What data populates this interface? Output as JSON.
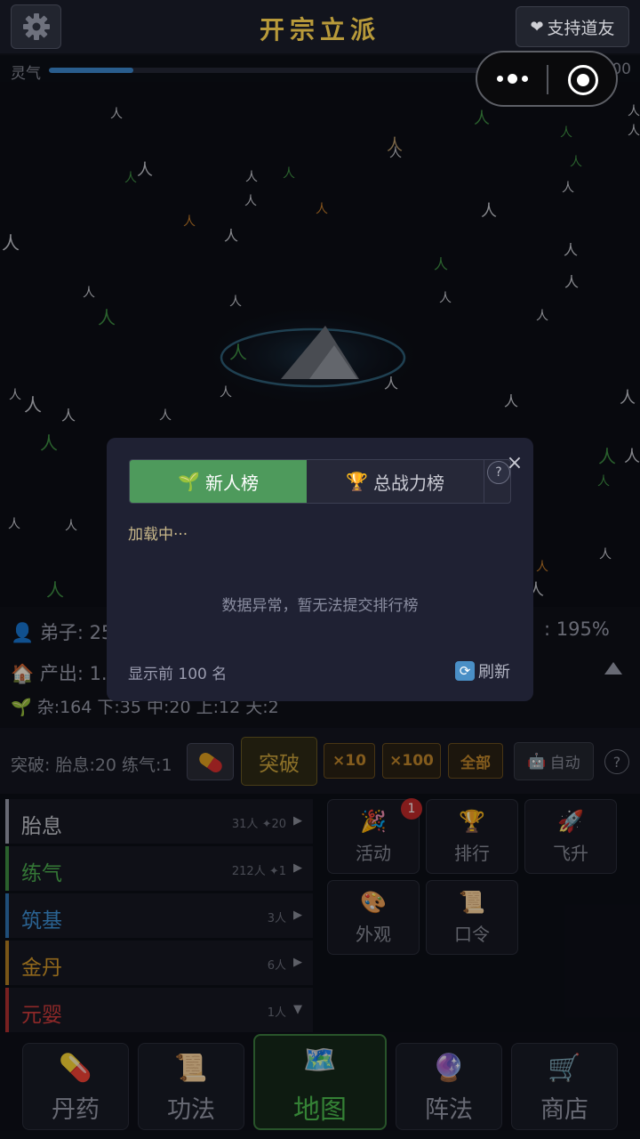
{
  "header": {
    "title": "开宗立派",
    "support_label": "支持道友",
    "settings_icon": "gear-icon",
    "support_icon": "heart-icon"
  },
  "lingqi": {
    "label": "灵气",
    "value_text": "3 / 2000",
    "fill_fraction": 0.17
  },
  "capsule": {
    "more_icon": "more-dots-icon",
    "close_icon": "close-target-icon"
  },
  "stats": {
    "disciples": "👤 弟子: 25",
    "output": "🏠 产出: 1.",
    "tiers": "🌱 杂:164 下:35 中:20 上:12 天:2",
    "percent": ": 195%"
  },
  "breakthrough": {
    "label": "突破: 胎息:20 练气:1",
    "pill_icon": "pill-icon",
    "button": "突破",
    "x10": "×10",
    "x100": "×100",
    "all": "全部",
    "auto": "自动",
    "help": "?"
  },
  "realms": [
    {
      "name": "胎息",
      "info": "31人 ✦20",
      "arrow": "▶",
      "color": "#c8c9d0",
      "bar": "#9a9cab"
    },
    {
      "name": "练气",
      "info": "212人 ✦1",
      "arrow": "▶",
      "color": "#4db050",
      "bar": "#3f8f43"
    },
    {
      "name": "筑基",
      "info": "3人",
      "arrow": "▶",
      "color": "#3f92d8",
      "bar": "#2f74b3"
    },
    {
      "name": "金丹",
      "info": "6人",
      "arrow": "▶",
      "color": "#d69a2a",
      "bar": "#b37f22"
    },
    {
      "name": "元婴",
      "info": "1人",
      "arrow": "▼",
      "color": "#d23c3c",
      "bar": "#b03030"
    }
  ],
  "tiles": [
    {
      "label": "活动",
      "icon": "🎉",
      "badge": "1"
    },
    {
      "label": "排行",
      "icon": "🏆"
    },
    {
      "label": "飞升",
      "icon": "🚀"
    },
    {
      "label": "外观",
      "icon": "🎨"
    },
    {
      "label": "口令",
      "icon": "📜"
    }
  ],
  "nav": [
    {
      "label": "丹药",
      "icon": "💊"
    },
    {
      "label": "功法",
      "icon": "📜"
    },
    {
      "label": "地图",
      "icon": "🗺️",
      "active": true
    },
    {
      "label": "阵法",
      "icon": "🔮"
    },
    {
      "label": "商店",
      "icon": "🛒"
    }
  ],
  "modal": {
    "tab_new": "新人榜",
    "tab_new_icon": "🌱",
    "tab_total": "总战力榜",
    "tab_total_icon": "🏆",
    "help": "?",
    "close": "×",
    "loading": "加载中···",
    "error": "数据异常，暂无法提交排行榜",
    "show_top": "显示前 100 名",
    "refresh": "刷新",
    "refresh_icon": "🔄"
  }
}
